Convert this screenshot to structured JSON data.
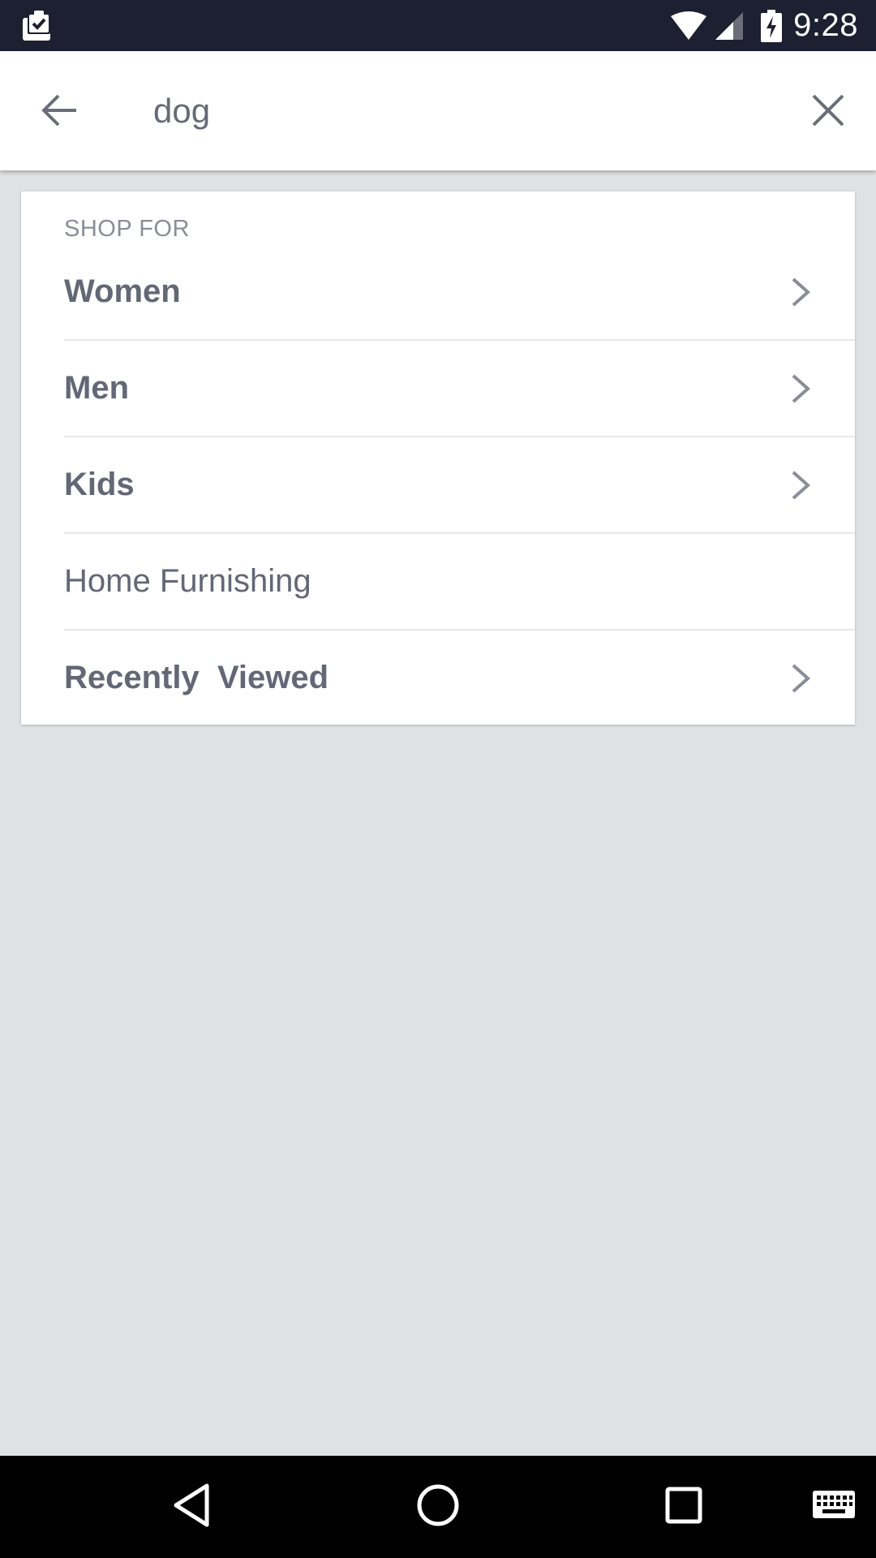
{
  "status_bar": {
    "time": "9:28",
    "icons": [
      "clipboard-check-icon",
      "wifi-icon",
      "signal-icon",
      "battery-charging-icon"
    ]
  },
  "search": {
    "query": "dog",
    "back_icon": "arrow-left-icon",
    "clear_icon": "close-icon"
  },
  "shop_for": {
    "label": "SHOP FOR",
    "items": [
      {
        "label": "Women",
        "has_chevron": true,
        "bold": true
      },
      {
        "label": "Men",
        "has_chevron": true,
        "bold": true
      },
      {
        "label": "Kids",
        "has_chevron": true,
        "bold": true
      },
      {
        "label": "Home Furnishing",
        "has_chevron": false,
        "bold": false
      },
      {
        "label": "Recently  Viewed",
        "has_chevron": true,
        "bold": true
      }
    ]
  },
  "nav_bar": {
    "icons": [
      "back-triangle-icon",
      "home-circle-icon",
      "recents-square-icon",
      "keyboard-icon"
    ]
  },
  "colors": {
    "status_bar_bg": "#1d2030",
    "background": "#e0e1e3",
    "text": "#636776",
    "label": "#8a8d98"
  }
}
